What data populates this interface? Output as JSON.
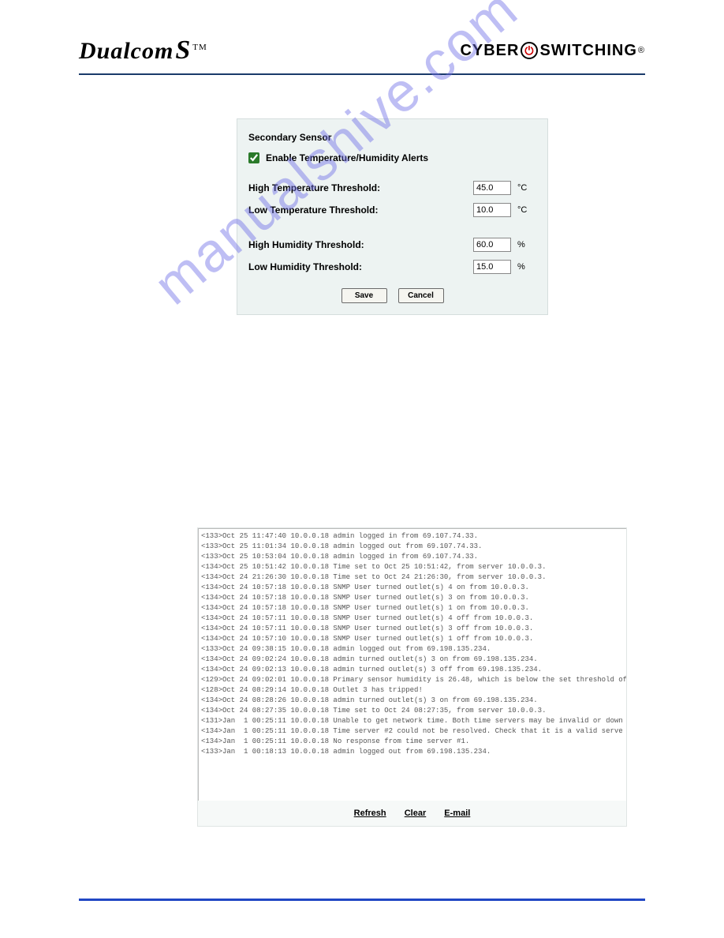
{
  "header": {
    "logo_left": "Dualcom",
    "logo_left_mark": "S",
    "logo_left_tm": "TM",
    "logo_right_a": "CYBER",
    "logo_right_b": "SWITCHING",
    "logo_right_reg": "®"
  },
  "panel": {
    "title": "Secondary Sensor",
    "enable_label": "Enable Temperature/Humidity Alerts",
    "enabled": true,
    "high_temp_label": "High Temperature Threshold:",
    "high_temp_value": "45.0",
    "low_temp_label": "Low Temperature Threshold:",
    "low_temp_value": "10.0",
    "temp_unit": "°C",
    "high_hum_label": "High Humidity Threshold:",
    "high_hum_value": "60.0",
    "low_hum_label": "Low Humidity Threshold:",
    "low_hum_value": "15.0",
    "hum_unit": "%",
    "save_label": "Save",
    "cancel_label": "Cancel"
  },
  "watermark": "manualshive.com",
  "log": {
    "lines": [
      "<133>Oct 25 11:47:40 10.0.0.18 admin logged in from 69.107.74.33.",
      "<133>Oct 25 11:01:34 10.0.0.18 admin logged out from 69.107.74.33.",
      "<133>Oct 25 10:53:04 10.0.0.18 admin logged in from 69.107.74.33.",
      "<134>Oct 25 10:51:42 10.0.0.18 Time set to Oct 25 10:51:42, from server 10.0.0.3.",
      "<134>Oct 24 21:26:30 10.0.0.18 Time set to Oct 24 21:26:30, from server 10.0.0.3.",
      "<134>Oct 24 10:57:18 10.0.0.18 SNMP User turned outlet(s) 4 on from 10.0.0.3.",
      "<134>Oct 24 10:57:18 10.0.0.18 SNMP User turned outlet(s) 3 on from 10.0.0.3.",
      "<134>Oct 24 10:57:18 10.0.0.18 SNMP User turned outlet(s) 1 on from 10.0.0.3.",
      "<134>Oct 24 10:57:11 10.0.0.18 SNMP User turned outlet(s) 4 off from 10.0.0.3.",
      "<134>Oct 24 10:57:11 10.0.0.18 SNMP User turned outlet(s) 3 off from 10.0.0.3.",
      "<134>Oct 24 10:57:10 10.0.0.18 SNMP User turned outlet(s) 1 off from 10.0.0.3.",
      "<133>Oct 24 09:38:15 10.0.0.18 admin logged out from 69.198.135.234.",
      "<134>Oct 24 09:02:24 10.0.0.18 admin turned outlet(s) 3 on from 69.198.135.234.",
      "<134>Oct 24 09:02:13 10.0.0.18 admin turned outlet(s) 3 off from 69.198.135.234.",
      "<129>Oct 24 09:02:01 10.0.0.18 Primary sensor humidity is 26.48, which is below the set threshold of",
      "<128>Oct 24 08:29:14 10.0.0.18 Outlet 3 has tripped!",
      "<134>Oct 24 08:28:26 10.0.0.18 admin turned outlet(s) 3 on from 69.198.135.234.",
      "<134>Oct 24 08:27:35 10.0.0.18 Time set to Oct 24 08:27:35, from server 10.0.0.3.",
      "<131>Jan  1 00:25:11 10.0.0.18 Unable to get network time. Both time servers may be invalid or down",
      "<134>Jan  1 00:25:11 10.0.0.18 Time server #2 could not be resolved. Check that it is a valid serve",
      "<134>Jan  1 00:25:11 10.0.0.18 No response from time server #1.",
      "<133>Jan  1 00:18:13 10.0.0.18 admin logged out from 69.198.135.234."
    ],
    "refresh_label": "Refresh",
    "clear_label": "Clear",
    "email_label": "E-mail"
  }
}
